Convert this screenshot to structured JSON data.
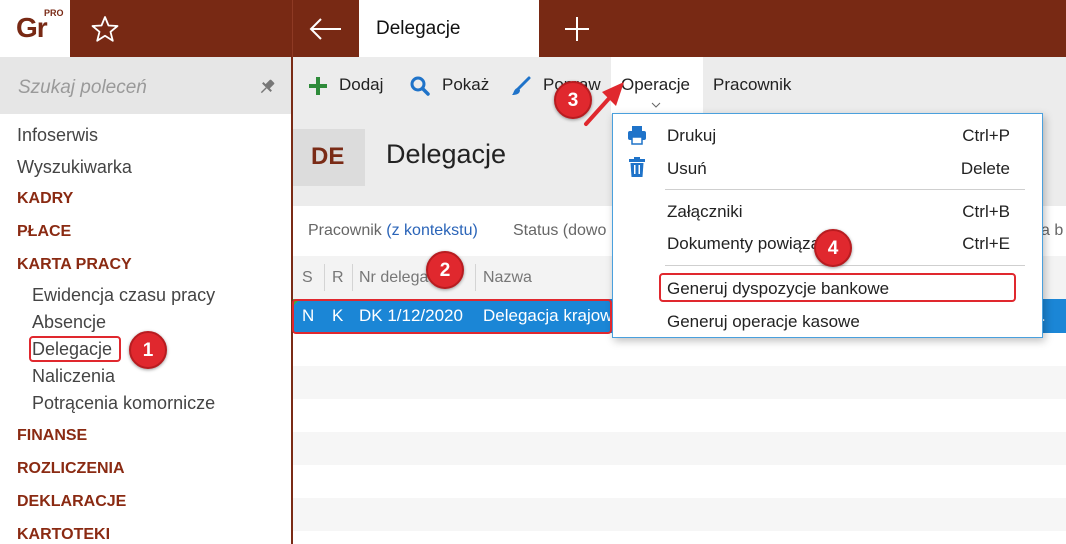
{
  "app": {
    "logo_text": "Gr",
    "logo_badge": "PRO",
    "active_tab": "Delegacje"
  },
  "sidebar": {
    "search_placeholder": "Szukaj poleceń",
    "items": [
      {
        "label": "Infoserwis"
      },
      {
        "label": "Wyszukiwarka"
      },
      {
        "label": "KADRY"
      },
      {
        "label": "PŁACE"
      },
      {
        "label": "KARTA PRACY"
      },
      {
        "label": "Ewidencja czasu pracy"
      },
      {
        "label": "Absencje"
      },
      {
        "label": "Delegacje"
      },
      {
        "label": "Naliczenia"
      },
      {
        "label": "Potrącenia komornicze"
      },
      {
        "label": "FINANSE"
      },
      {
        "label": "ROZLICZENIA"
      },
      {
        "label": "DEKLARACJE"
      },
      {
        "label": "KARTOTEKI"
      }
    ]
  },
  "toolbar": {
    "add": "Dodaj",
    "show": "Pokaż",
    "edit": "Popraw",
    "operations": "Operacje",
    "employee": "Pracownik"
  },
  "page": {
    "badge": "DE",
    "title": "Delegacje"
  },
  "filters": {
    "employee_label": "Pracownik",
    "employee_context": "(z kontekstu)",
    "status_label": "Status (dowo",
    "right_fragment": "a b"
  },
  "table": {
    "headers": [
      "S",
      "R",
      "Nr delegacji",
      "Nazwa"
    ],
    "rows": [
      {
        "s": "N",
        "r": "K",
        "number": "DK 1/12/2020",
        "name": "Delegacja krajow"
      }
    ],
    "right_fragment": "."
  },
  "menu": {
    "items": [
      {
        "label": "Drukuj",
        "shortcut": "Ctrl+P",
        "icon": "printer-icon"
      },
      {
        "label": "Usuń",
        "shortcut": "Delete",
        "icon": "trash-icon"
      },
      {
        "label": "Załączniki",
        "shortcut": "Ctrl+B"
      },
      {
        "label": "Dokumenty powiązane",
        "shortcut": "Ctrl+E"
      },
      {
        "label": "Generuj dyspozycje bankowe",
        "shortcut": ""
      },
      {
        "label": "Generuj operacje kasowe",
        "shortcut": ""
      }
    ]
  },
  "annotations": {
    "steps": [
      "1",
      "2",
      "3",
      "4"
    ]
  },
  "colors": {
    "brand": "#782914",
    "section": "#8a2a12",
    "selection": "#1b86d6",
    "annotation": "#e0282e",
    "link": "#2a64b8"
  }
}
